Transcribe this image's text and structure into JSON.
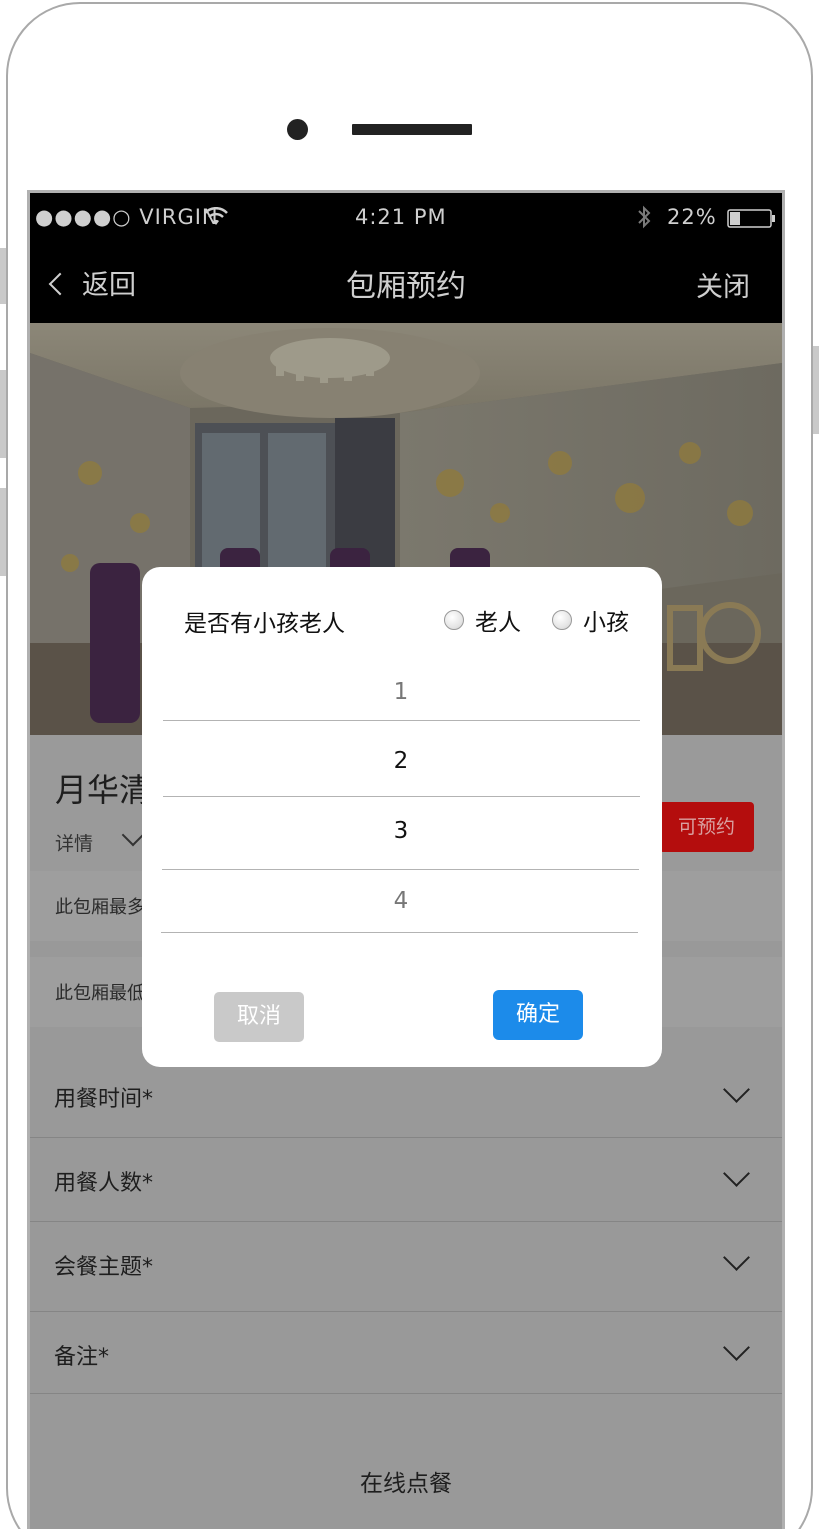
{
  "status_bar": {
    "carrier": "●●●●○ VIRGIN",
    "time": "4:21 PM",
    "battery": "22%"
  },
  "nav": {
    "back_label": "返回",
    "title": "包厢预约",
    "close_label": "关闭"
  },
  "room": {
    "name": "月华清",
    "details_label": "详情",
    "status_badge": "可预约",
    "info_max": "此包厢最多",
    "info_min": "此包厢最低"
  },
  "form_fields": [
    {
      "label": "用餐时间*"
    },
    {
      "label": "用餐人数*"
    },
    {
      "label": "会餐主题*"
    },
    {
      "label": "备注*"
    }
  ],
  "order_button": "在线点餐",
  "modal": {
    "question": "是否有小孩老人",
    "options": [
      "老人",
      "小孩"
    ],
    "picker_values": [
      "1",
      "2",
      "3",
      "4"
    ],
    "cancel_label": "取消",
    "confirm_label": "确定"
  },
  "colors": {
    "accent": "#1c8bea",
    "badge": "#b40d0d",
    "nav_bg": "#000000"
  }
}
